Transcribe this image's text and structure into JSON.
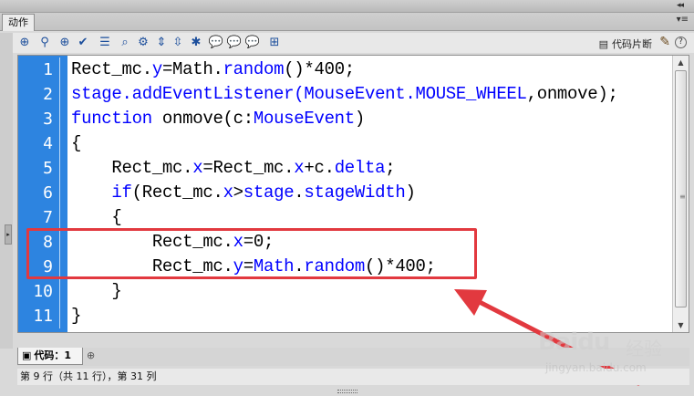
{
  "panel": {
    "tab_label": "动作",
    "top_arrows": "◂◂",
    "tab_menu": "▾≡"
  },
  "toolbar": {
    "icons": [
      {
        "name": "add-statement-icon",
        "glyph": "⊕"
      },
      {
        "name": "find-icon",
        "glyph": "⚲"
      },
      {
        "name": "target-path-icon",
        "glyph": "⊕"
      },
      {
        "name": "check-syntax-icon",
        "glyph": "✔"
      },
      {
        "name": "auto-format-icon",
        "glyph": "☰"
      },
      {
        "name": "show-code-hint-icon",
        "glyph": "⌕"
      },
      {
        "name": "debug-options-icon",
        "glyph": "⚙"
      },
      {
        "name": "collapse-between-braces-icon",
        "glyph": "⇕"
      },
      {
        "name": "collapse-selection-icon",
        "glyph": "⇳"
      },
      {
        "name": "expand-all-icon",
        "glyph": "✱"
      },
      {
        "name": "apply-block-comment-icon",
        "glyph": "💬"
      },
      {
        "name": "apply-line-comment-icon",
        "glyph": "💬"
      },
      {
        "name": "remove-comment-icon",
        "glyph": "💬"
      },
      {
        "name": "show-hide-toolbox-icon",
        "glyph": "⊞"
      }
    ],
    "snippets_label": "代码片断",
    "help_label": "?"
  },
  "editor": {
    "line_numbers": [
      "1",
      "2",
      "3",
      "4",
      "5",
      "6",
      "7",
      "8",
      "9",
      "10",
      "11"
    ],
    "lines": [
      [
        {
          "t": "Rect_mc."
        },
        {
          "t": "y",
          "c": "prop"
        },
        {
          "t": "=Math."
        },
        {
          "t": "random",
          "c": "prop"
        },
        {
          "t": "()*400;"
        }
      ],
      [
        {
          "t": "stage.",
          "c": "prop"
        },
        {
          "t": "addEventListener",
          "c": "prop"
        },
        {
          "t": "(MouseEvent.",
          "c": "prop"
        },
        {
          "t": "MOUSE_WHEEL",
          "c": "prop"
        },
        {
          "t": ",onmove);"
        }
      ],
      [
        {
          "t": "function",
          "c": "kw"
        },
        {
          "t": " onmove(c:"
        },
        {
          "t": "MouseEvent",
          "c": "prop"
        },
        {
          "t": ")"
        }
      ],
      [
        {
          "t": "{"
        }
      ],
      [
        {
          "t": "    Rect_mc."
        },
        {
          "t": "x",
          "c": "prop"
        },
        {
          "t": "=Rect_mc."
        },
        {
          "t": "x",
          "c": "prop"
        },
        {
          "t": "+c."
        },
        {
          "t": "delta",
          "c": "prop"
        },
        {
          "t": ";"
        }
      ],
      [
        {
          "t": "    "
        },
        {
          "t": "if",
          "c": "kw"
        },
        {
          "t": "(Rect_mc."
        },
        {
          "t": "x",
          "c": "prop"
        },
        {
          "t": ">"
        },
        {
          "t": "stage",
          "c": "prop"
        },
        {
          "t": "."
        },
        {
          "t": "stageWidth",
          "c": "prop"
        },
        {
          "t": ")"
        }
      ],
      [
        {
          "t": "    {"
        }
      ],
      [
        {
          "t": "        Rect_mc."
        },
        {
          "t": "x",
          "c": "prop"
        },
        {
          "t": "=0;"
        }
      ],
      [
        {
          "t": "        Rect_mc."
        },
        {
          "t": "y",
          "c": "prop"
        },
        {
          "t": "="
        },
        {
          "t": "Math",
          "c": "prop"
        },
        {
          "t": "."
        },
        {
          "t": "random",
          "c": "prop"
        },
        {
          "t": "()*400;"
        }
      ],
      [
        {
          "t": "    }"
        }
      ],
      [
        {
          "t": "}"
        }
      ]
    ]
  },
  "bottom": {
    "code_tab_label": "代码：1",
    "status_text": "第 9 行（共 11 行），第 31 列"
  },
  "watermark": {
    "logo": "Bai",
    "logo_rest": "du",
    "logo_cn": "经验",
    "url": "jingyan.baidu.com"
  },
  "colors": {
    "gutter": "#2d84e0",
    "keyword": "#0000ff",
    "highlight": "#e2393f"
  }
}
